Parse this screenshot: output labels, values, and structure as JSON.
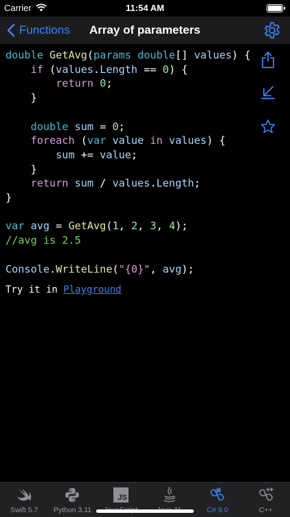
{
  "status": {
    "carrier": "Carrier",
    "time": "11:54 AM"
  },
  "nav": {
    "back_label": "Functions",
    "title": "Array of parameters"
  },
  "code": {
    "l1": {
      "kw1": "double",
      "fn": "GetAvg",
      "open": "(",
      "kw2": "params",
      "kw3": "double",
      "rest": "[] ",
      "var": "values",
      "close": ") {"
    },
    "l2": {
      "indent": "    ",
      "kw": "if",
      "a": " (",
      "var": "values",
      "dot": ".",
      "prop": "Length",
      "eq": " == ",
      "num": "0",
      "close": ") {"
    },
    "l3": {
      "indent": "        ",
      "kw": "return",
      "sp": " ",
      "num": "0",
      "end": ";"
    },
    "l4": "    }",
    "l6": {
      "indent": "    ",
      "kw": "double",
      "sp": " ",
      "var": "sum",
      "eq": " = ",
      "num": "0",
      "end": ";"
    },
    "l7": {
      "indent": "    ",
      "kw": "foreach",
      "a": " (",
      "kw2": "var",
      "sp": " ",
      "v1": "value",
      "in_sp": " ",
      "kw3": "in",
      "sp2": " ",
      "v2": "values",
      "close": ") {"
    },
    "l8": {
      "indent": "        ",
      "v1": "sum",
      "op": " += ",
      "v2": "value",
      "end": ";"
    },
    "l9": "    }",
    "l10": {
      "indent": "    ",
      "kw": "return",
      "sp": " ",
      "v1": "sum",
      "op": " / ",
      "v2": "values",
      "dot": ".",
      "prop": "Length",
      "end": ";"
    },
    "l11": "}",
    "l13": {
      "kw": "var",
      "sp": " ",
      "v": "avg",
      "eq": " = ",
      "fn": "GetAvg",
      "open": "(",
      "n1": "1",
      "c1": ", ",
      "n2": "2",
      "c2": ", ",
      "n3": "3",
      "c3": ", ",
      "n4": "4",
      "end": ");"
    },
    "l14": "//avg is 2.5",
    "l16": {
      "cls": "Console",
      "dot": ".",
      "fn": "WriteLine",
      "open": "(",
      "q1": "\"",
      "fmt": "{0}",
      "q2": "\"",
      "sep": ", ",
      "v": "avg",
      "end": ");"
    }
  },
  "try": {
    "prefix": "Try it in ",
    "link": "Playground"
  },
  "tabs": [
    {
      "label": "Swift 5.7",
      "icon": "swift-icon"
    },
    {
      "label": "Python 3.11",
      "icon": "python-icon"
    },
    {
      "label": "JavaScript",
      "icon": "javascript-icon",
      "glyph": "JS"
    },
    {
      "label": "Java 11",
      "icon": "java-icon"
    },
    {
      "label": "C# 9.0",
      "icon": "csharp-icon",
      "active": true
    },
    {
      "label": "C++",
      "icon": "cplusplus-icon"
    }
  ],
  "colors": {
    "accent": "#3a82f7",
    "background": "#000000",
    "keyword": "#3ec1d3",
    "function": "#e8e9a1",
    "number": "#a8e6a3",
    "comment": "#7bd35f"
  }
}
